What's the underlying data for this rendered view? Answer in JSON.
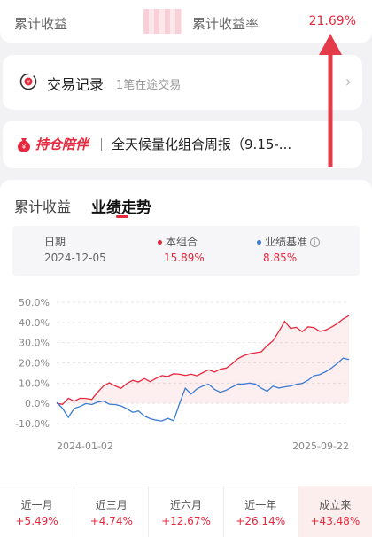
{
  "summary": {
    "cum_return_label": "累计收益",
    "cum_rate_label": "累计收益率",
    "cum_rate_value": "21.69%"
  },
  "trade": {
    "title": "交易记录",
    "subtitle": "1笔在途交易"
  },
  "report": {
    "logo": "持仓陪伴",
    "text": "全天候量化组合周报（9.15-..."
  },
  "tabs": [
    "累计收益",
    "业绩走势"
  ],
  "info": {
    "date_label": "日期",
    "date_value": "2024-12-05",
    "series_a_label": "本组合",
    "series_a_value": "15.89%",
    "series_b_label": "业绩基准",
    "series_b_value": "8.85%"
  },
  "periods": [
    {
      "label": "近一月",
      "value": "+5.49%"
    },
    {
      "label": "近三月",
      "value": "+4.74%"
    },
    {
      "label": "近六月",
      "value": "+12.67%"
    },
    {
      "label": "近一年",
      "value": "+26.14%"
    },
    {
      "label": "成立来",
      "value": "+43.48%"
    }
  ],
  "colors": {
    "red": "#e7283d",
    "blue": "#3a7bd5"
  },
  "chart_data": {
    "type": "line",
    "x_start": "2024-01-02",
    "x_end": "2025-09-22",
    "y_ticks": [
      "50.0%",
      "40.0%",
      "30.0%",
      "20.0%",
      "10.0%",
      "0.0%",
      "-10.0%"
    ],
    "ylim": [
      -10,
      50
    ],
    "series": [
      {
        "name": "本组合",
        "values": [
          0,
          -1,
          2,
          1,
          3,
          3,
          2,
          5,
          8,
          10,
          9,
          8,
          10,
          11,
          10,
          12,
          11,
          13,
          14,
          13,
          14,
          14,
          14,
          15,
          14,
          15,
          16,
          15,
          17,
          18,
          20,
          22,
          23,
          24,
          25,
          26,
          29,
          31,
          35,
          40,
          37,
          38,
          36,
          38,
          37,
          35,
          36,
          38,
          40,
          42,
          43
        ]
      },
      {
        "name": "业绩基准",
        "values": [
          0,
          -3,
          -7,
          -2,
          -1,
          0,
          -1,
          0,
          1,
          0,
          0,
          -1,
          -3,
          -5,
          -4,
          -6,
          -7,
          -8,
          -9,
          -8,
          -9,
          0,
          8,
          5,
          7,
          8,
          9,
          7,
          6,
          7,
          8,
          9,
          9,
          10,
          10,
          8,
          6,
          8,
          7,
          8,
          9,
          10,
          10,
          11,
          13,
          14,
          16,
          18,
          20,
          22,
          21
        ]
      }
    ]
  }
}
